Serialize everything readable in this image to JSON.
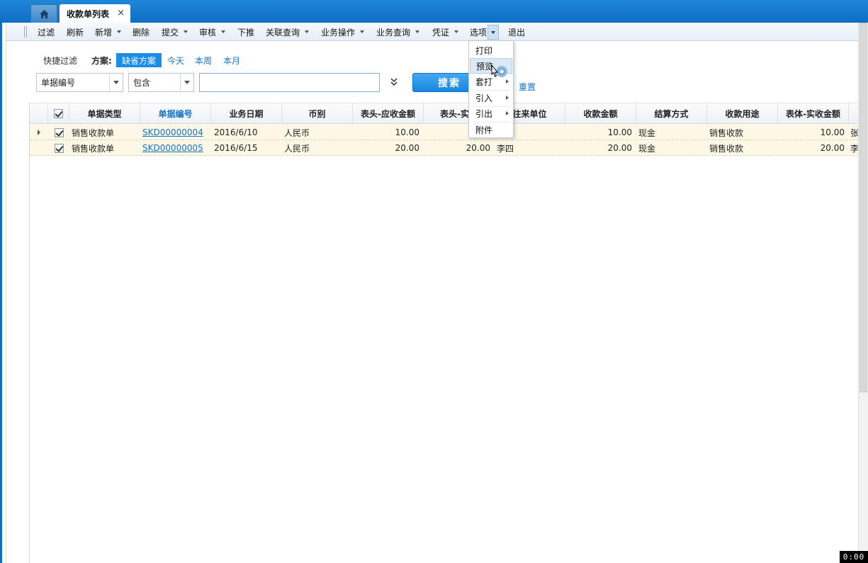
{
  "tabs": {
    "doc_tab_label": "收款单列表",
    "close_glyph": "×"
  },
  "toolbar": {
    "filter": "过滤",
    "refresh": "刷新",
    "add": "新增",
    "delete": "删除",
    "submit": "提交",
    "audit": "审核",
    "push_down": "下推",
    "related_query": "关联查询",
    "business_ops": "业务操作",
    "business_query": "业务查询",
    "voucher": "凭证",
    "options": "选项",
    "exit": "退出"
  },
  "filter": {
    "quick_filter_label": "快捷过滤",
    "scheme_label": "方案:",
    "scheme_default": "缺省方案",
    "scheme_today": "今天",
    "scheme_week": "本周",
    "scheme_month": "本月",
    "field_value": "单据编号",
    "operator_value": "包含",
    "search_value": "",
    "search_button": "搜索",
    "reset_link": "重置"
  },
  "grid": {
    "columns": [
      "单据类型",
      "单据编号",
      "业务日期",
      "币别",
      "表头-应收金额",
      "表头-实收",
      "往来单位",
      "收款金额",
      "结算方式",
      "收款用途",
      "表体-实收金额"
    ],
    "rows": [
      {
        "type": "销售收款单",
        "number": "SKD00000004",
        "date": "2016/6/10",
        "currency": "人民币",
        "head_receivable": "10.00",
        "head_received": "",
        "partner": "",
        "amount": "10.00",
        "settlement": "现金",
        "purpose": "销售收款",
        "body_received": "10.00",
        "extra": "张"
      },
      {
        "type": "销售收款单",
        "number": "SKD00000005",
        "date": "2016/6/15",
        "currency": "人民币",
        "head_receivable": "20.00",
        "head_received": "20.00",
        "partner": "李四",
        "amount": "20.00",
        "settlement": "现金",
        "purpose": "销售收款",
        "body_received": "20.00",
        "extra": "李"
      }
    ]
  },
  "options_menu": {
    "print": "打印",
    "preview": "预览",
    "template_print": "套打",
    "import": "引入",
    "export": "引出",
    "attachment": "附件"
  },
  "timer": "0:00",
  "icons": {
    "home": "home-icon",
    "expand": "double-chevron-down-icon",
    "cursor": "hand-pointer-icon"
  },
  "colors": {
    "tabbar_blue": "#0d6fc4",
    "accent_blue": "#1a8ee6",
    "link_blue": "#1473c4",
    "row_highlight": "#fdf8e6"
  }
}
